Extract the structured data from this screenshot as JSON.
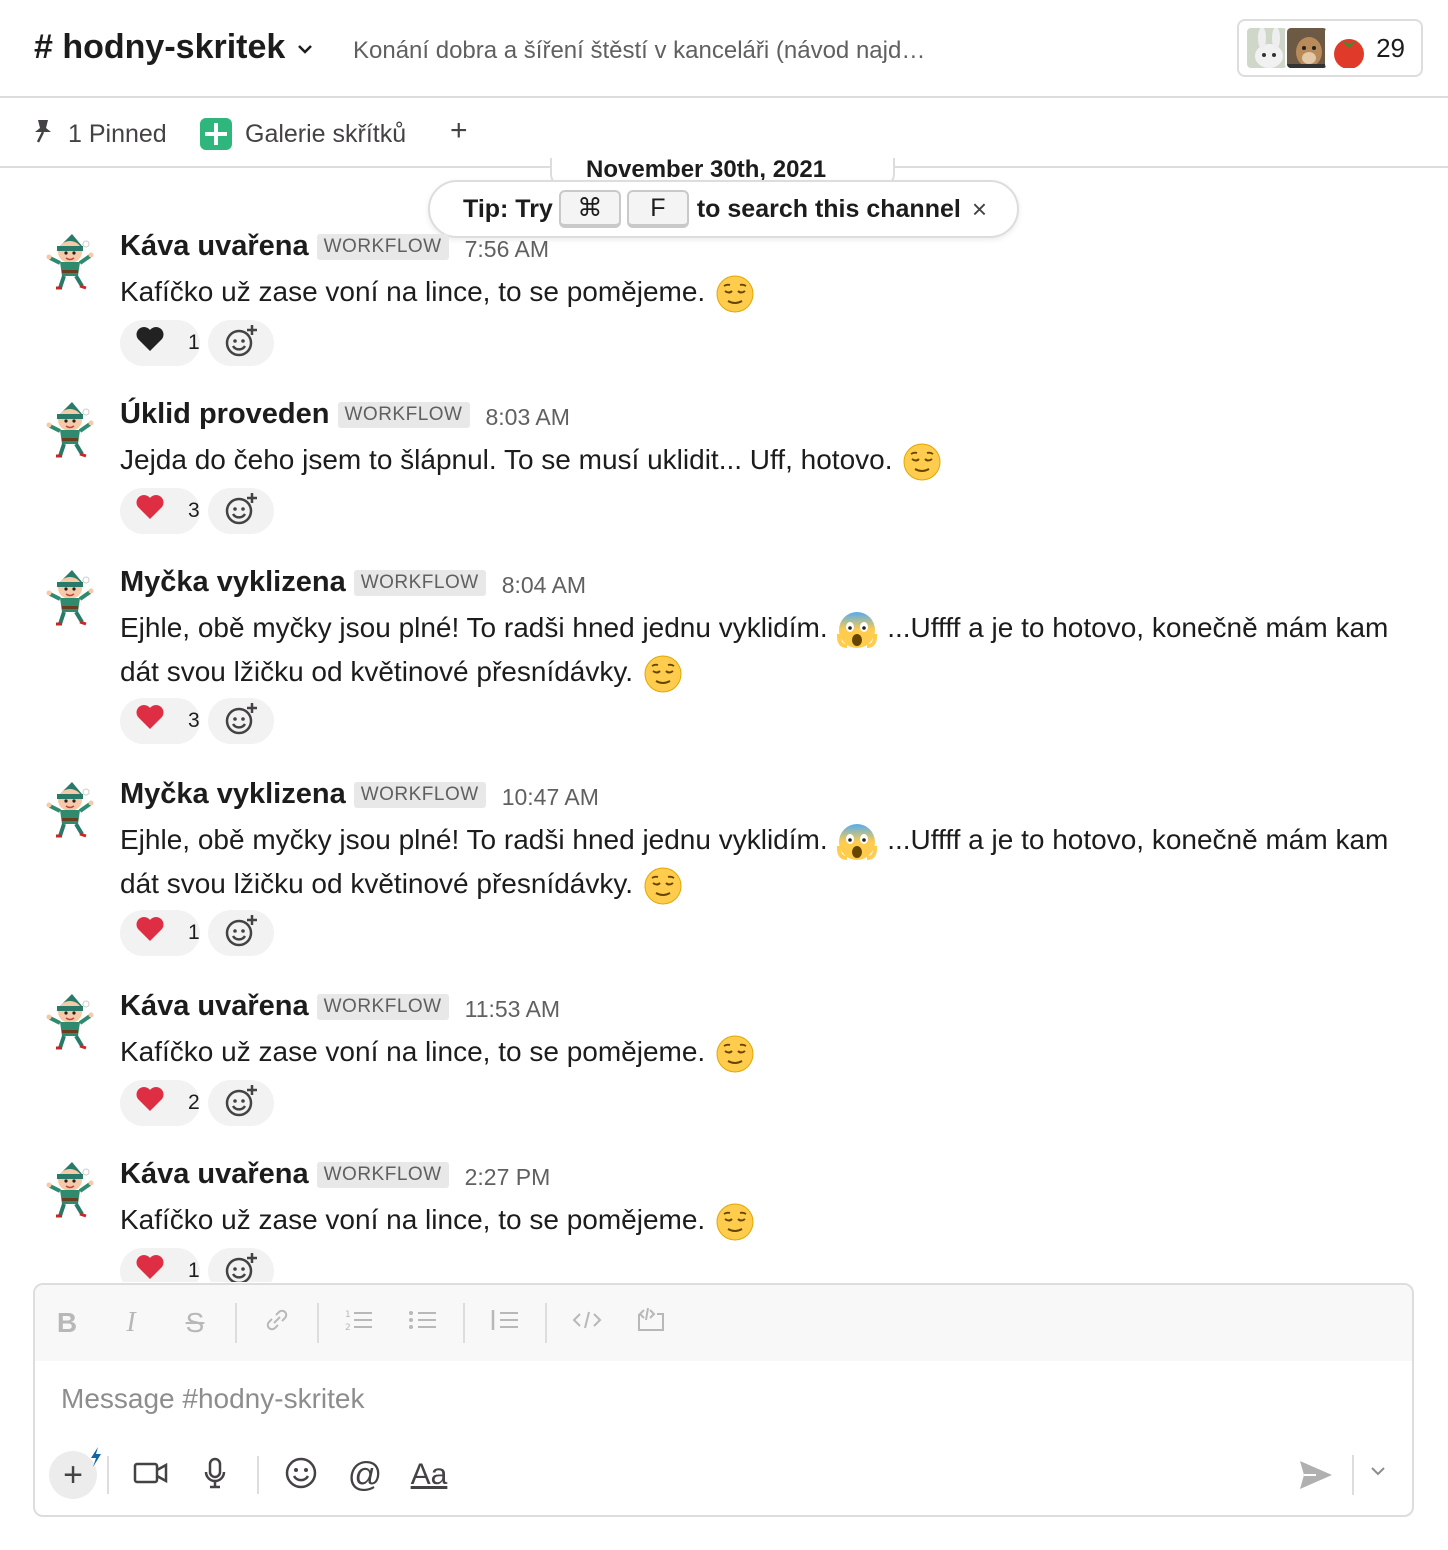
{
  "header": {
    "channel_name": "# hodny-skritek",
    "topic": "Konání dobra a šíření štěstí v kanceláři (návod najd…",
    "member_count": "29"
  },
  "bookmarks": {
    "pinned": "1 Pinned",
    "gallery": "Galerie skřítků",
    "add": "+"
  },
  "date_divider": "November 30th, 2021",
  "tip": {
    "prefix": "Tip: Try",
    "key1": "⌘",
    "key2": "F",
    "suffix": "to search this channel",
    "close": "×"
  },
  "messages": [
    {
      "author": "Káva uvařena",
      "badge": "WORKFLOW",
      "time": "7:56 AM",
      "text": "Kafíčko už zase voní na lince, to se pomějeme.",
      "reaction": "black-heart",
      "count": "1"
    },
    {
      "author": "Úklid proveden",
      "badge": "WORKFLOW",
      "time": "8:03 AM",
      "text": "Jejda do čeho jsem to šlápnul. To se musí uklidit... Uff, hotovo.",
      "reaction": "red-heart",
      "count": "3"
    },
    {
      "author": "Myčka vyklizena",
      "badge": "WORKFLOW",
      "time": "8:04 AM",
      "text_a": "Ejhle, obě myčky jsou plné! To radši hned jednu vyklidím.",
      "text_b": "...Uffff a je to hotovo, konečně mám kam dát svou lžičku od květinové přesnídávky.",
      "reaction": "red-heart",
      "count": "3"
    },
    {
      "author": "Myčka vyklizena",
      "badge": "WORKFLOW",
      "time": "10:47 AM",
      "text_a": "Ejhle, obě myčky jsou plné! To radši hned jednu vyklidím.",
      "text_b": "...Uffff a je to hotovo, konečně mám kam dát svou lžičku od květinové přesnídávky.",
      "reaction": "red-heart",
      "count": "1"
    },
    {
      "author": "Káva uvařena",
      "badge": "WORKFLOW",
      "time": "11:53 AM",
      "text": "Kafíčko už zase voní na lince, to se pomějeme.",
      "reaction": "red-heart",
      "count": "2"
    },
    {
      "author": "Káva uvařena",
      "badge": "WORKFLOW",
      "time": "2:27 PM",
      "text": "Kafíčko už zase voní na lince, to se pomějeme.",
      "reaction": "red-heart",
      "count": "1"
    }
  ],
  "composer": {
    "placeholder": "Message #hodny-skritek",
    "format_aa": "Aa"
  },
  "colors": {
    "accent_green": "#2eb67d",
    "text": "#1d1c1d",
    "muted": "#616061",
    "heart_red": "#dd2e44"
  }
}
